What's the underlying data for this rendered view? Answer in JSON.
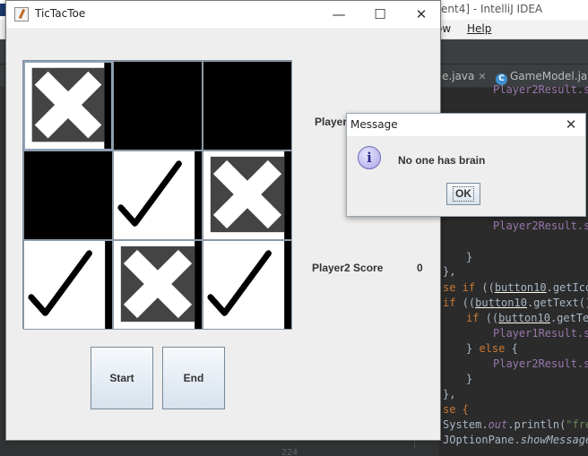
{
  "ide": {
    "title": "ent4] - IntelliJ IDEA",
    "menus": [
      {
        "label": "ow"
      },
      {
        "label": "Help"
      }
    ],
    "tabs": [
      {
        "label": "e.java"
      },
      {
        "label": "GameModel.java"
      }
    ],
    "code_lines": [
      "Player2Result.se",
      "Player2Result.se",
      "}",
      "},",
      "se if ((button10.getIcon",
      "if ((button10.getText()",
      "if ((button10.getTex",
      "Player1Result.se",
      "} else {",
      "Player2Result.se",
      "}",
      "},",
      "se {",
      "System.out.println(\"free",
      "JOptionPane.showMessage"
    ],
    "line_number": "224"
  },
  "game": {
    "title": "TicTacToe",
    "window_controls": [
      "—",
      "☐",
      "✕"
    ],
    "board": [
      {
        "mark": "X",
        "bg": "light"
      },
      {
        "mark": "",
        "bg": "dark"
      },
      {
        "mark": "",
        "bg": "dark"
      },
      {
        "mark": "",
        "bg": "dark"
      },
      {
        "mark": "check",
        "bg": "light"
      },
      {
        "mark": "X",
        "bg": "light"
      },
      {
        "mark": "check",
        "bg": "light"
      },
      {
        "mark": "X",
        "bg": "light"
      },
      {
        "mark": "check",
        "bg": "light"
      }
    ],
    "player1_label": "Player",
    "player2_label": "Player2 Score",
    "player2_score": "0",
    "start_label": "Start",
    "end_label": "End"
  },
  "dialog": {
    "title": "Message",
    "close": "✕",
    "info_icon": "i",
    "message": "No one has brain",
    "ok_label": "OK"
  },
  "colors": {
    "ide_bg": "#2b2b2b",
    "keyword": "#cc7832",
    "field": "#9876aa",
    "window_bg": "#eeeeee"
  }
}
